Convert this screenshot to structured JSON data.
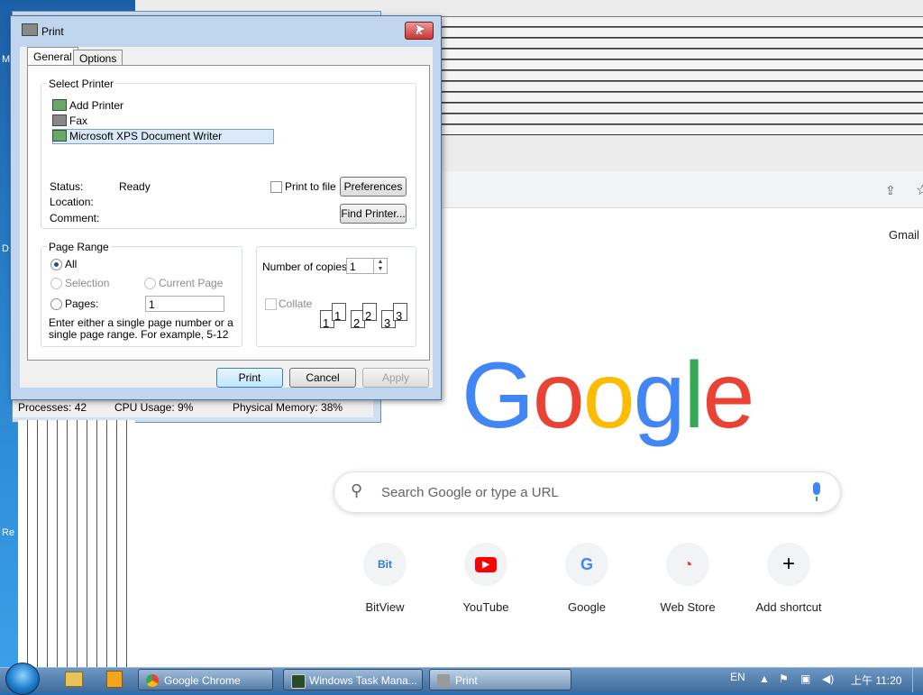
{
  "desktop": {
    "side_labels": [
      "M",
      "D",
      "Re"
    ]
  },
  "chrome": {
    "gmail_link": "Gmail",
    "logo_text": "Google",
    "search_placeholder": "Search Google or type a URL",
    "shortcuts": [
      {
        "label": "BitView",
        "icon": "Bit\nView",
        "color": "#2e7bd0"
      },
      {
        "label": "YouTube",
        "icon": "▶",
        "color": "#ff0000"
      },
      {
        "label": "Google",
        "icon": "G",
        "color": "#4285f4"
      },
      {
        "label": "Web Store",
        "icon": "◔",
        "color": "#ea4335"
      },
      {
        "label": "Add shortcut",
        "icon": "+",
        "color": "#202124"
      }
    ]
  },
  "taskmgr": {
    "processes": "Processes: 42",
    "cpu": "CPU Usage: 9%",
    "memory": "Physical Memory: 38%"
  },
  "print_dialog": {
    "title": "Print",
    "close_label": "x",
    "tabs": [
      "General",
      "Options"
    ],
    "select_printer_label": "Select Printer",
    "printers": [
      "Add Printer",
      "Fax",
      "Microsoft XPS Document Writer"
    ],
    "status_label": "Status:",
    "status_value": "Ready",
    "location_label": "Location:",
    "comment_label": "Comment:",
    "print_to_file": "Print to file",
    "preferences": "Preferences",
    "find_printer": "Find Printer...",
    "page_range_label": "Page Range",
    "all": "All",
    "selection": "Selection",
    "current_page": "Current Page",
    "pages": "Pages:",
    "pages_value": "1",
    "hint": "Enter either a single page number or a single page range.  For example, 5-12",
    "copies_label": "Number of copies:",
    "copies_value": "1",
    "collate": "Collate",
    "print_btn": "Print",
    "cancel_btn": "Cancel",
    "apply_btn": "Apply"
  },
  "taskbar": {
    "buttons": [
      "Google Chrome",
      "Windows Task Mana...",
      "Print"
    ],
    "lang": "EN",
    "clock": "上午 11:20"
  },
  "colors": {
    "google_blue": "#4285f4",
    "google_red": "#ea4335",
    "google_yellow": "#fbbc05",
    "google_green": "#34a853"
  }
}
